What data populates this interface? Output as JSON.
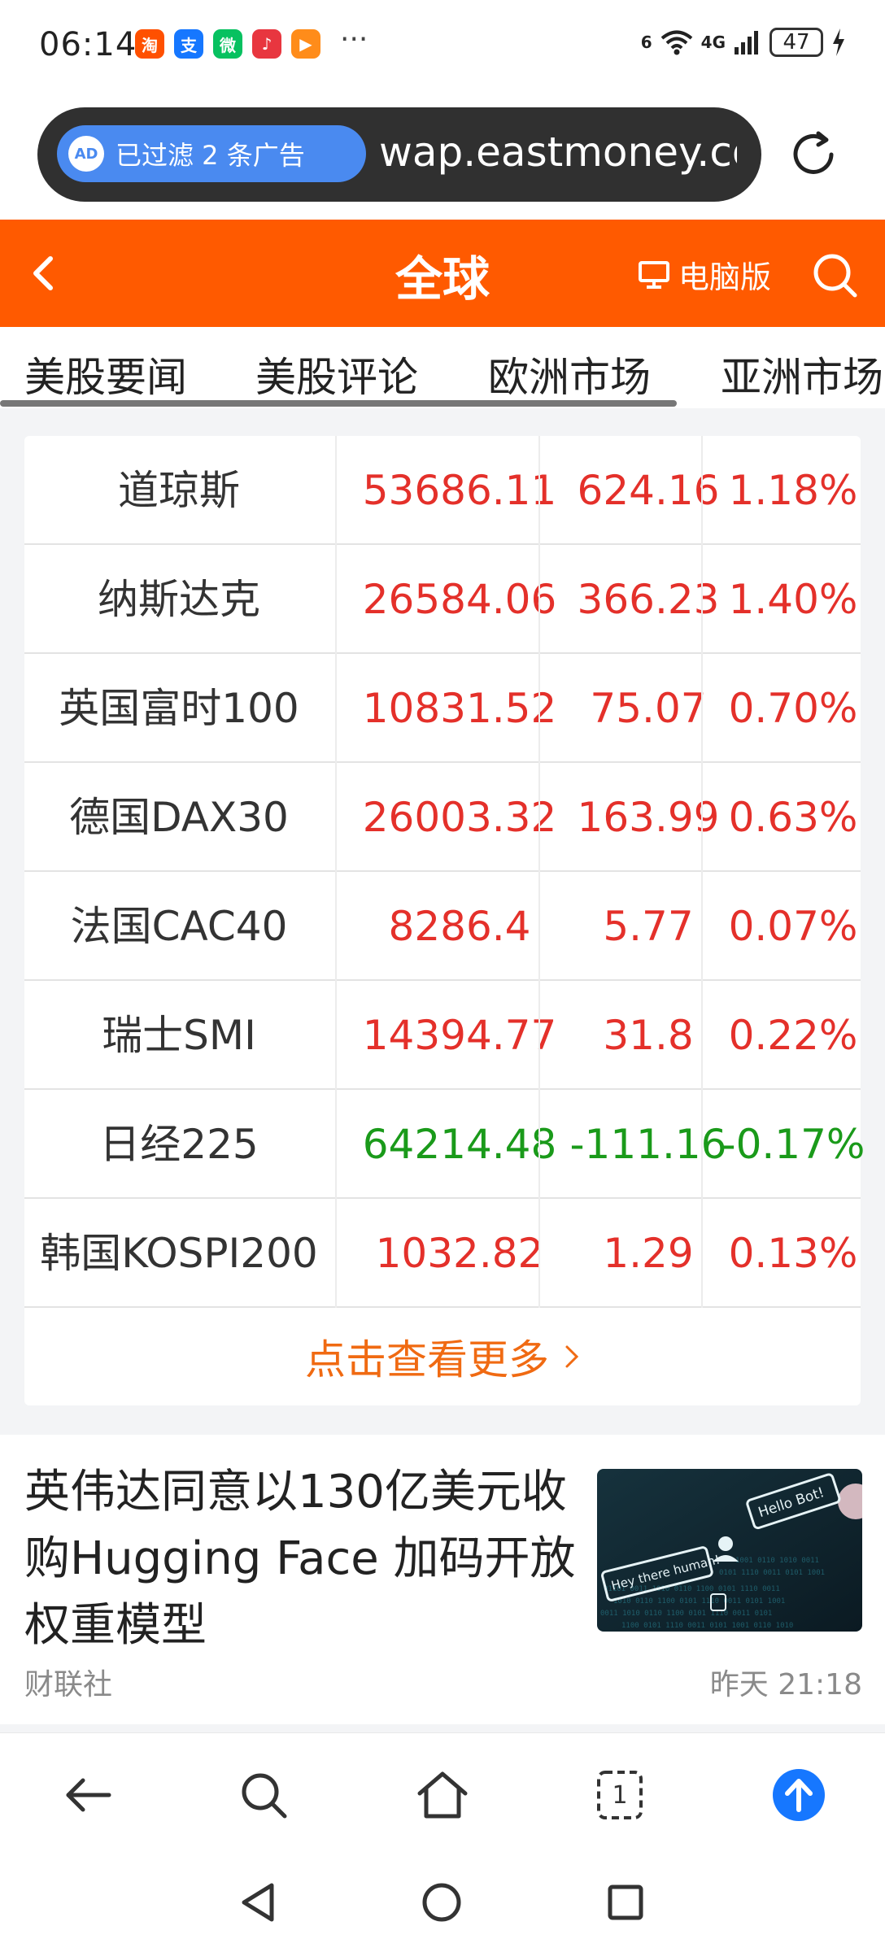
{
  "status_bar": {
    "time": "06:14",
    "more": "···",
    "signal_label_1": "6",
    "signal_label_2": "4G",
    "battery": "47",
    "app_icons": [
      {
        "name": "taobao-icon",
        "glyph": "淘",
        "color": "#ff5000"
      },
      {
        "name": "alipay-icon",
        "glyph": "支",
        "color": "#1677ff"
      },
      {
        "name": "wechat-icon",
        "glyph": "微",
        "color": "#07c160"
      },
      {
        "name": "music-icon",
        "glyph": "♪",
        "color": "#e8363f"
      },
      {
        "name": "video-icon",
        "glyph": "▶",
        "color": "#ff8c1a"
      }
    ]
  },
  "address_bar": {
    "ad_badge": "AD",
    "ad_filter": "已过滤 2 条广告",
    "url": "wap.eastmoney.com/"
  },
  "header": {
    "title": "全球",
    "pc_version": "电脑版"
  },
  "tabs": [
    "美股要闻",
    "美股评论",
    "欧洲市场",
    "亚洲市场"
  ],
  "quotes": [
    {
      "name": "道琼斯",
      "price": "53686.11",
      "change": "624.16",
      "pct": "1.18%",
      "dir": "up"
    },
    {
      "name": "纳斯达克",
      "price": "26584.06",
      "change": "366.23",
      "pct": "1.40%",
      "dir": "up"
    },
    {
      "name": "英国富时100",
      "price": "10831.52",
      "change": "75.07",
      "pct": "0.70%",
      "dir": "up"
    },
    {
      "name": "德国DAX30",
      "price": "26003.32",
      "change": "163.99",
      "pct": "0.63%",
      "dir": "up"
    },
    {
      "name": "法国CAC40",
      "price": "8286.4",
      "change": "5.77",
      "pct": "0.07%",
      "dir": "up"
    },
    {
      "name": "瑞士SMI",
      "price": "14394.77",
      "change": "31.8",
      "pct": "0.22%",
      "dir": "up"
    },
    {
      "name": "日经225",
      "price": "64214.48",
      "change": "-111.16",
      "pct": "-0.17%",
      "dir": "down"
    },
    {
      "name": "韩国KOSPI200",
      "price": "1032.82",
      "change": "1.29",
      "pct": "0.13%",
      "dir": "up"
    }
  ],
  "more_label": "点击查看更多",
  "news": {
    "title": "英伟达同意以130亿美元收购Hugging Face 加码开放权重模型",
    "source": "财联社",
    "time": "昨天 21:18",
    "thumb_text_1": "Hello Bot!",
    "thumb_text_2": "Hey there human!"
  },
  "bottom_bar": {
    "tab_count": "1"
  },
  "colors": {
    "brand_orange": "#ff5a00",
    "up_red": "#e4302a",
    "down_green": "#1a9a1a",
    "accent_blue": "#1677ff"
  }
}
